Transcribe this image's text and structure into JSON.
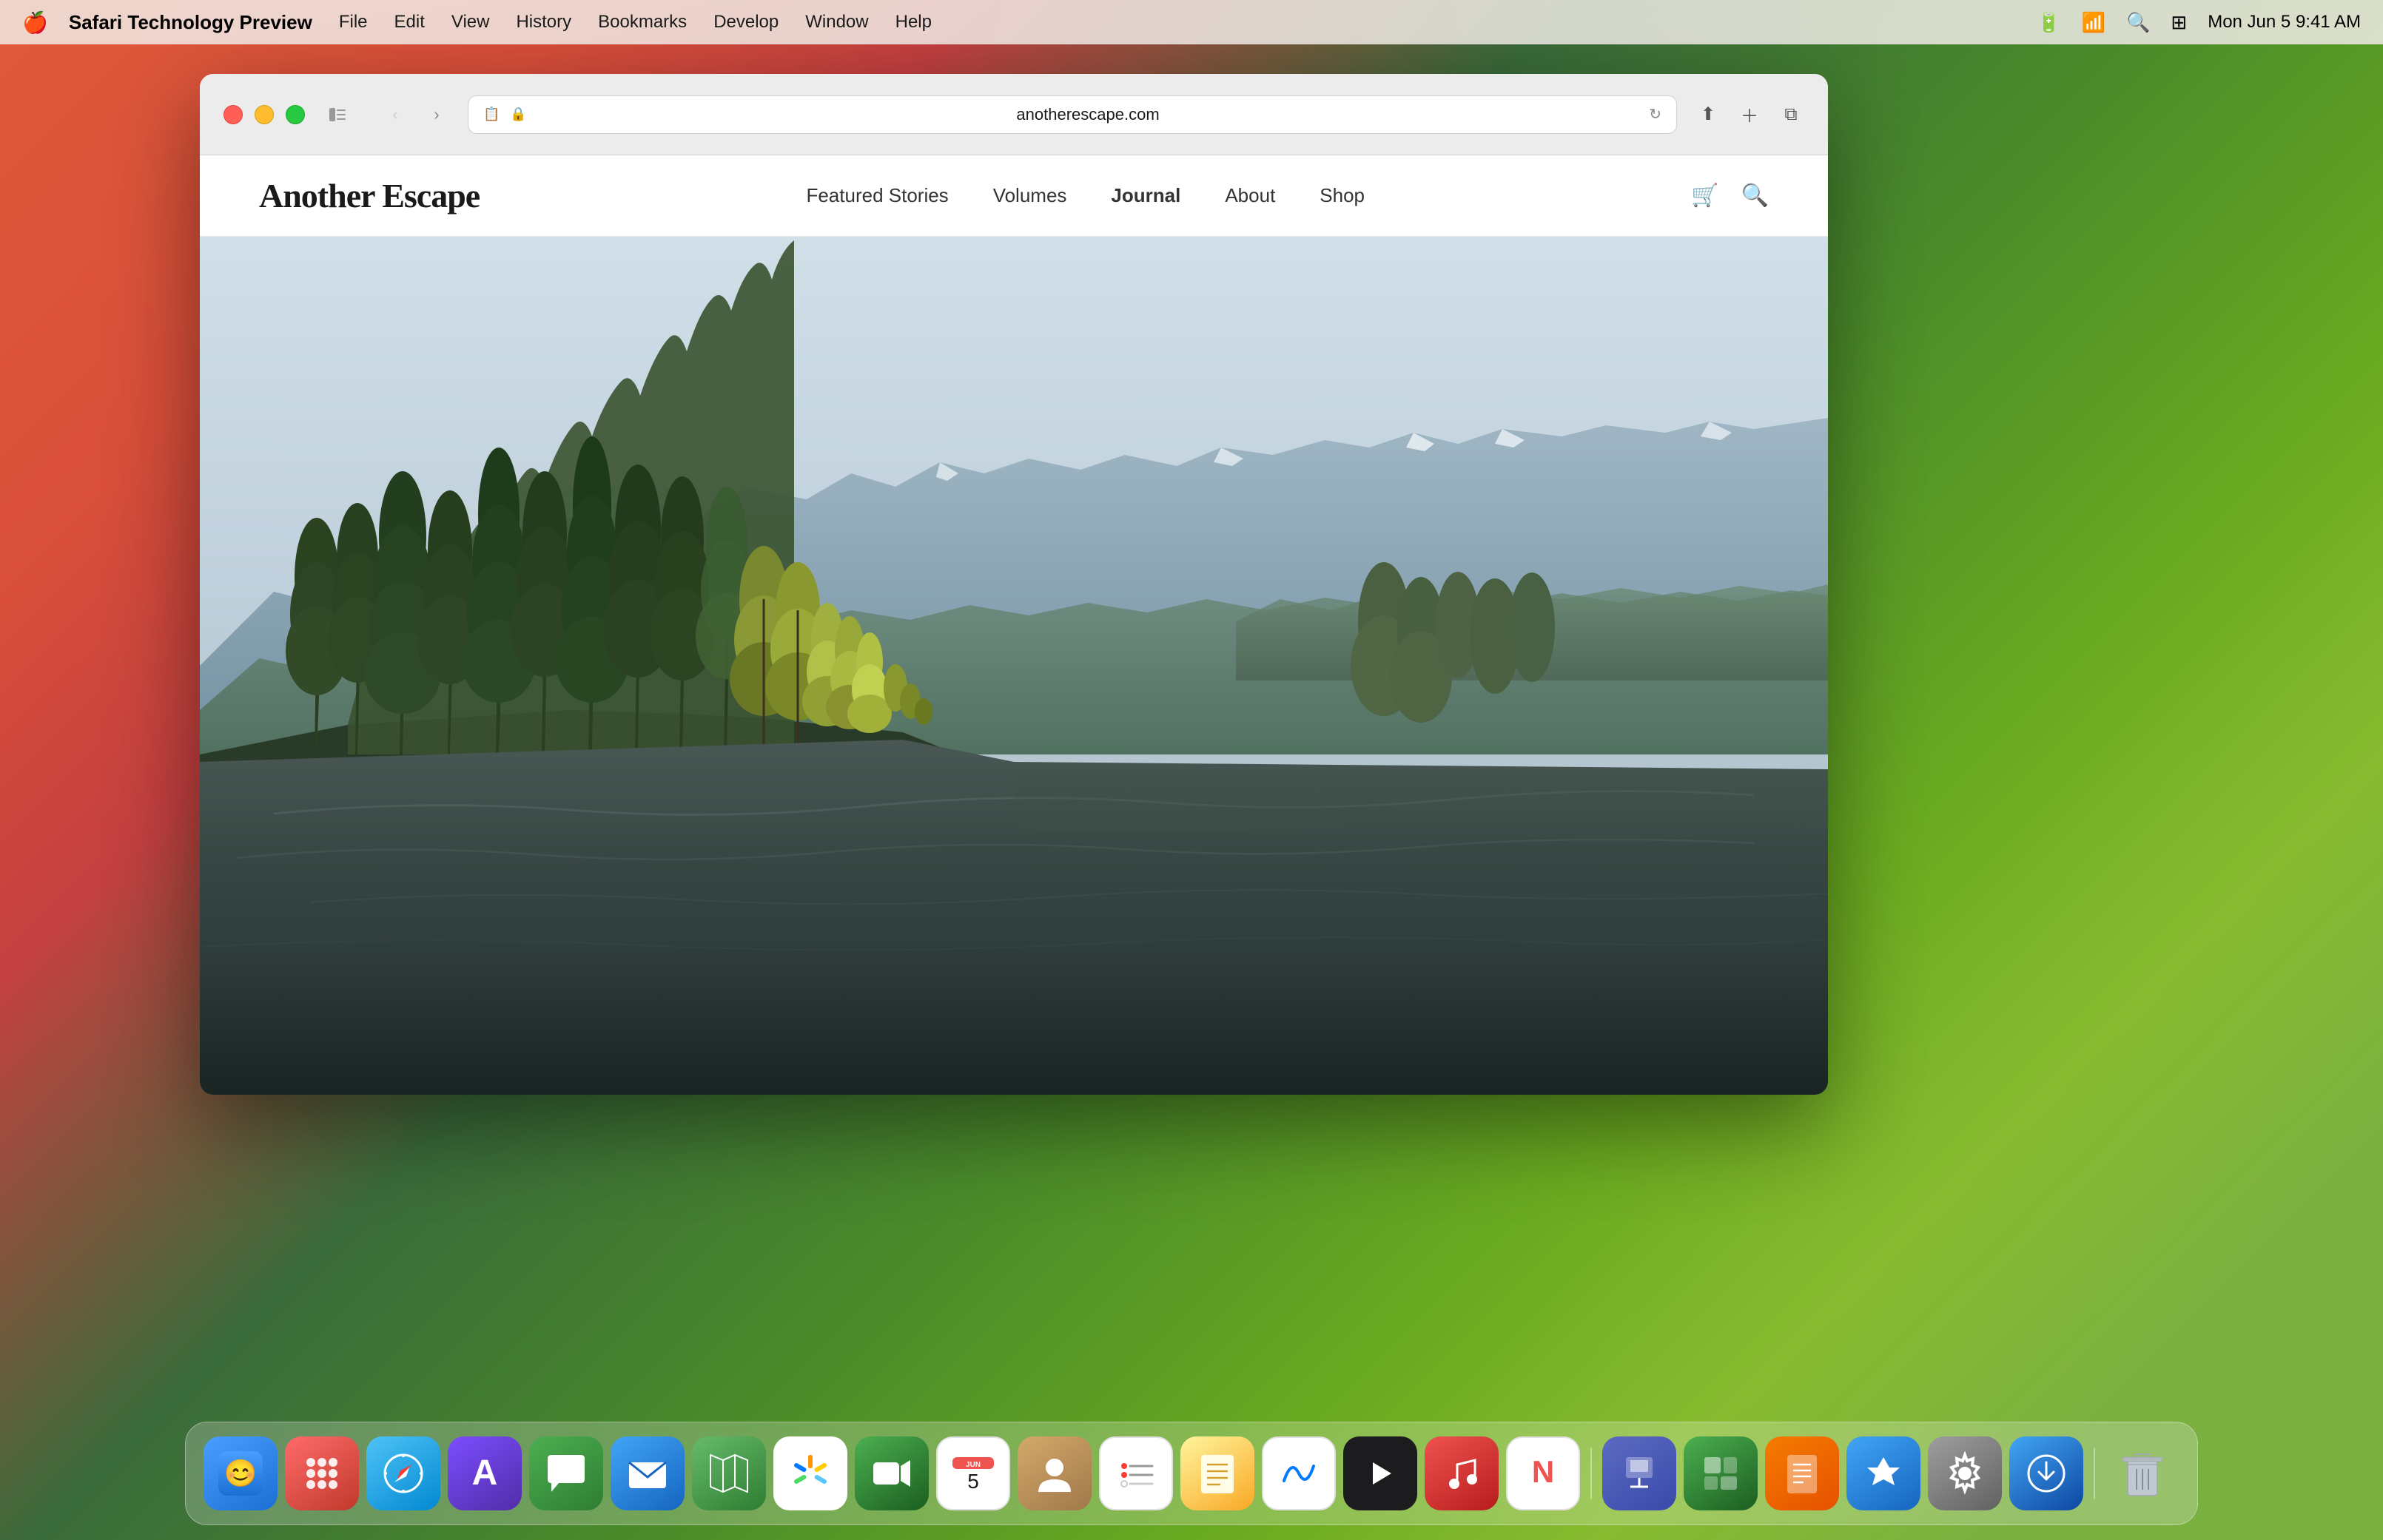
{
  "menubar": {
    "apple_symbol": "🍎",
    "app_name": "Safari Technology Preview",
    "items": [
      "File",
      "Edit",
      "View",
      "History",
      "Bookmarks",
      "Develop",
      "Window",
      "Help"
    ],
    "time": "Mon Jun 5  9:41 AM"
  },
  "browser": {
    "url": "anotherescape.com",
    "tab_icon": "📄",
    "lock_icon": "🔒",
    "reload_icon": "↻"
  },
  "website": {
    "logo": "Another Escape",
    "nav": {
      "items": [
        {
          "label": "Featured Stories",
          "active": false
        },
        {
          "label": "Volumes",
          "active": false
        },
        {
          "label": "Journal",
          "active": false,
          "bold": true
        },
        {
          "label": "About",
          "active": false
        },
        {
          "label": "Shop",
          "active": false
        }
      ]
    }
  },
  "dock": {
    "apps": [
      {
        "name": "Finder",
        "emoji": "🖥",
        "class": "app-finder"
      },
      {
        "name": "Launchpad",
        "emoji": "⊞",
        "class": "app-launchpad"
      },
      {
        "name": "Safari",
        "emoji": "⑆",
        "class": "app-safari"
      },
      {
        "name": "IA Writer",
        "emoji": "A",
        "class": "app-ia-writer"
      },
      {
        "name": "Messages",
        "emoji": "💬",
        "class": "app-messages"
      },
      {
        "name": "Mail",
        "emoji": "✉",
        "class": "app-mail"
      },
      {
        "name": "Maps",
        "emoji": "📍",
        "class": "app-maps"
      },
      {
        "name": "Photos",
        "emoji": "🌺",
        "class": "app-photos"
      },
      {
        "name": "FaceTime",
        "emoji": "📹",
        "class": "app-facetime"
      },
      {
        "name": "Calendar",
        "emoji": "📅",
        "class": "app-calendar"
      },
      {
        "name": "Contacts",
        "emoji": "👤",
        "class": "app-contacts"
      },
      {
        "name": "Reminders",
        "emoji": "≡",
        "class": "app-reminders"
      },
      {
        "name": "Notes",
        "emoji": "📝",
        "class": "app-notes"
      },
      {
        "name": "Freeform",
        "emoji": "∞",
        "class": "app-freeform"
      },
      {
        "name": "Apple TV",
        "emoji": "▶",
        "class": "app-appletv"
      },
      {
        "name": "Music",
        "emoji": "♪",
        "class": "app-music"
      },
      {
        "name": "News",
        "emoji": "N",
        "class": "app-news"
      },
      {
        "name": "Keynote",
        "emoji": "◈",
        "class": "app-keynote"
      },
      {
        "name": "Numbers",
        "emoji": "⊞",
        "class": "app-numbers"
      },
      {
        "name": "Pages",
        "emoji": "✎",
        "class": "app-pages"
      },
      {
        "name": "App Store",
        "emoji": "A",
        "class": "app-appstore"
      },
      {
        "name": "System Settings",
        "emoji": "⚙",
        "class": "app-settings"
      },
      {
        "name": "Download",
        "emoji": "↓",
        "class": "app-download"
      },
      {
        "name": "Trash",
        "emoji": "🗑",
        "class": "app-trash"
      }
    ]
  }
}
